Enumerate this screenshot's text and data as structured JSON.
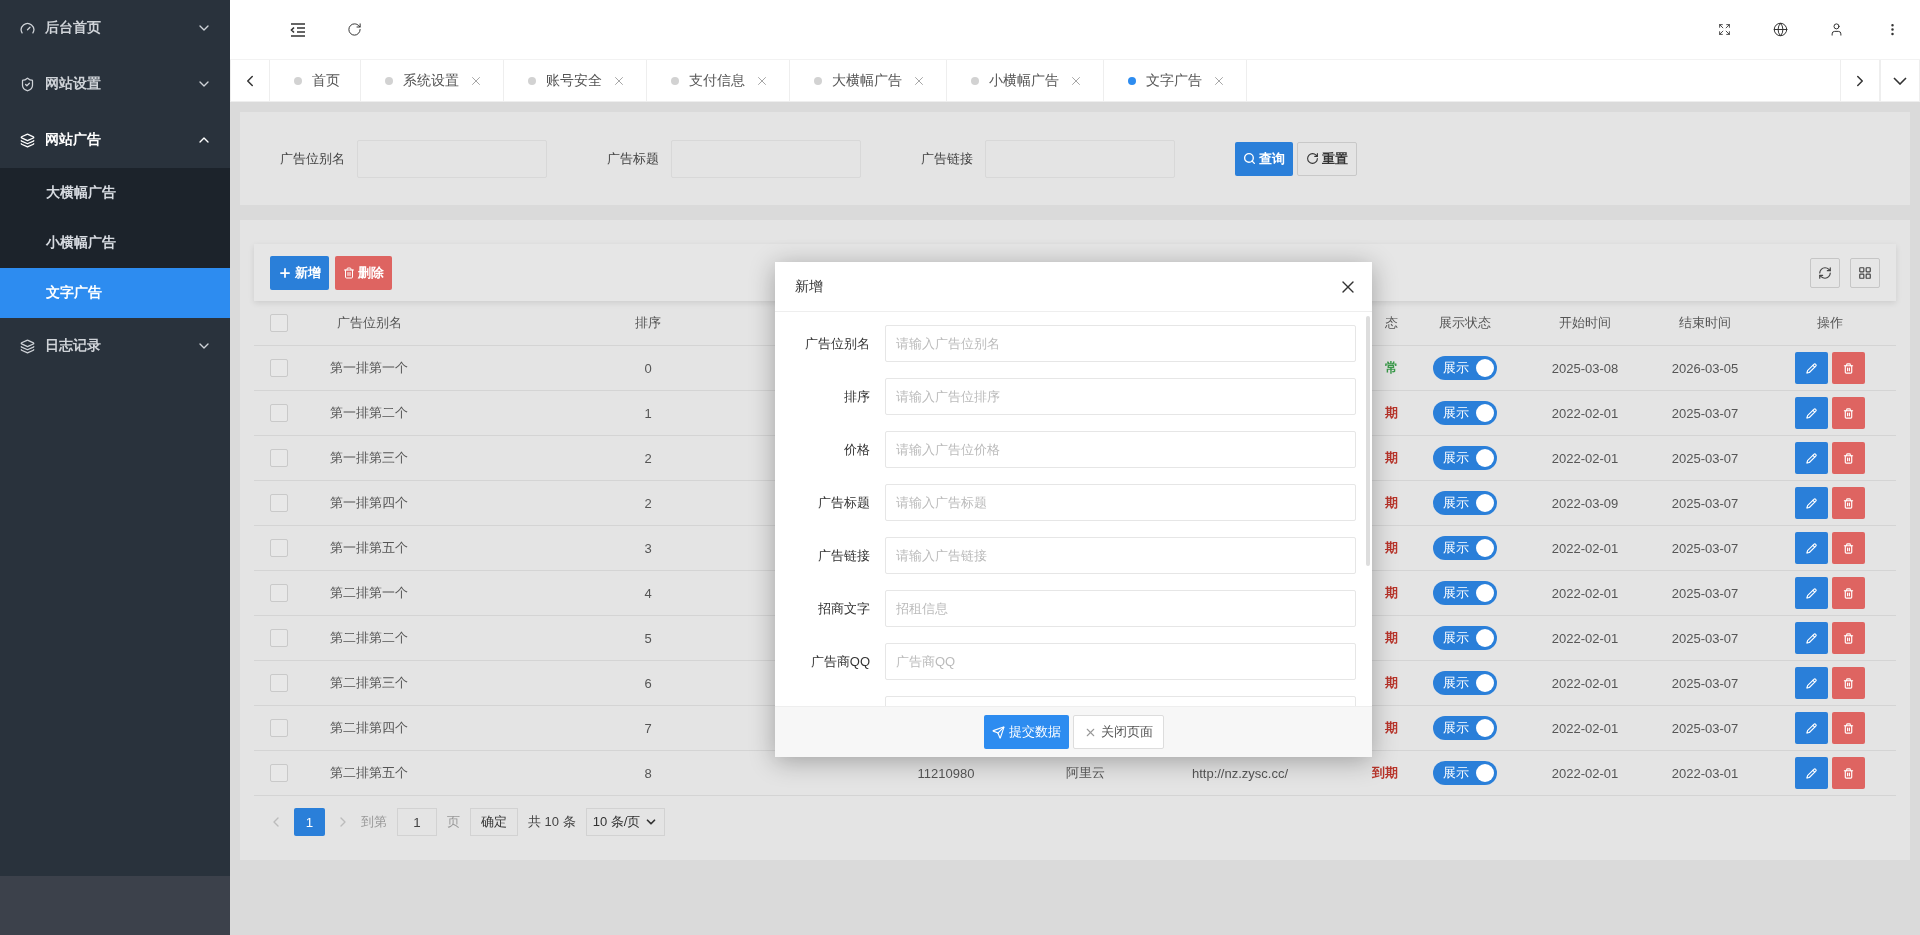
{
  "sidebar": {
    "items": [
      {
        "label": "后台首页",
        "expanded": false
      },
      {
        "label": "网站设置",
        "expanded": false
      },
      {
        "label": "网站广告",
        "expanded": true,
        "children": [
          {
            "label": "大横幅广告",
            "selected": false
          },
          {
            "label": "小横幅广告",
            "selected": false
          },
          {
            "label": "文字广告",
            "selected": true
          }
        ]
      },
      {
        "label": "日志记录",
        "expanded": false
      }
    ]
  },
  "tabs": [
    {
      "label": "首页",
      "selected": false,
      "closable": false
    },
    {
      "label": "系统设置",
      "selected": false,
      "closable": true
    },
    {
      "label": "账号安全",
      "selected": false,
      "closable": true
    },
    {
      "label": "支付信息",
      "selected": false,
      "closable": true
    },
    {
      "label": "大横幅广告",
      "selected": false,
      "closable": true
    },
    {
      "label": "小横幅广告",
      "selected": false,
      "closable": true
    },
    {
      "label": "文字广告",
      "selected": true,
      "closable": true
    }
  ],
  "search_form": {
    "fields": [
      {
        "label": "广告位别名"
      },
      {
        "label": "广告标题"
      },
      {
        "label": "广告链接"
      }
    ],
    "query_button": "查询",
    "reset_button": "重置"
  },
  "toolbar": {
    "add_button": "新增",
    "delete_button": "删除"
  },
  "table": {
    "header_checked": false,
    "columns": [
      "广告位别名",
      "排序",
      "态",
      "展示状态",
      "开始时间",
      "结束时间",
      "操作"
    ],
    "rows": [
      {
        "checked": false,
        "name": "第一排第一个",
        "sort": "0",
        "status": {
          "text": "常",
          "color": "#3a9a4a"
        },
        "show": {
          "label": "展示",
          "on": true
        },
        "start": "2025-03-08",
        "end": "2026-03-05"
      },
      {
        "checked": false,
        "name": "第一排第二个",
        "sort": "1",
        "status": {
          "text": "期",
          "color": "#b8342a"
        },
        "show": {
          "label": "展示",
          "on": true
        },
        "start": "2022-02-01",
        "end": "2025-03-07"
      },
      {
        "checked": false,
        "name": "第一排第三个",
        "sort": "2",
        "status": {
          "text": "期",
          "color": "#b8342a"
        },
        "show": {
          "label": "展示",
          "on": true
        },
        "start": "2022-02-01",
        "end": "2025-03-07"
      },
      {
        "checked": false,
        "name": "第一排第四个",
        "sort": "2",
        "status": {
          "text": "期",
          "color": "#b8342a"
        },
        "show": {
          "label": "展示",
          "on": true
        },
        "start": "2022-03-09",
        "end": "2025-03-07"
      },
      {
        "checked": false,
        "name": "第一排第五个",
        "sort": "3",
        "status": {
          "text": "期",
          "color": "#b8342a"
        },
        "show": {
          "label": "展示",
          "on": true
        },
        "start": "2022-02-01",
        "end": "2025-03-07"
      },
      {
        "checked": false,
        "name": "第二排第一个",
        "sort": "4",
        "status": {
          "text": "期",
          "color": "#b8342a"
        },
        "show": {
          "label": "展示",
          "on": true
        },
        "start": "2022-02-01",
        "end": "2025-03-07"
      },
      {
        "checked": false,
        "name": "第二排第二个",
        "sort": "5",
        "status": {
          "text": "期",
          "color": "#b8342a"
        },
        "show": {
          "label": "展示",
          "on": true
        },
        "start": "2022-02-01",
        "end": "2025-03-07"
      },
      {
        "checked": false,
        "name": "第二排第三个",
        "sort": "6",
        "status": {
          "text": "期",
          "color": "#b8342a"
        },
        "show": {
          "label": "展示",
          "on": true
        },
        "start": "2022-02-01",
        "end": "2025-03-07"
      },
      {
        "checked": false,
        "name": "第二排第四个",
        "sort": "7",
        "status": {
          "text": "期",
          "color": "#b8342a"
        },
        "show": {
          "label": "展示",
          "on": true
        },
        "start": "2022-02-01",
        "end": "2025-03-07"
      },
      {
        "checked": false,
        "name": "第二排第五个",
        "sort": "8",
        "qq": "11210980",
        "provider": "阿里云",
        "url": "http://nz.zysc.cc/",
        "status": {
          "text": "到期",
          "color": "#b8342a"
        },
        "show": {
          "label": "展示",
          "on": true
        },
        "start": "2022-02-01",
        "end": "2022-03-01"
      }
    ]
  },
  "pagination": {
    "pages": [
      {
        "label": "1",
        "selected": true
      }
    ],
    "goto_label": "到第",
    "page_input": "1",
    "page_unit": "页",
    "confirm": "确定",
    "total": "共 10 条",
    "page_size": "10 条/页"
  },
  "modal": {
    "title": "新增",
    "fields": [
      {
        "label": "广告位别名",
        "placeholder": "请输入广告位别名"
      },
      {
        "label": "排序",
        "placeholder": "请输入广告位排序"
      },
      {
        "label": "价格",
        "placeholder": "请输入广告位价格"
      },
      {
        "label": "广告标题",
        "placeholder": "请输入广告标题"
      },
      {
        "label": "广告链接",
        "placeholder": "请输入广告链接"
      },
      {
        "label": "招商文字",
        "placeholder": "招租信息"
      },
      {
        "label": "广告商QQ",
        "placeholder": "广告商QQ"
      }
    ],
    "more_fields_below": true,
    "submit_button": "提交数据",
    "close_button": "关闭页面"
  }
}
